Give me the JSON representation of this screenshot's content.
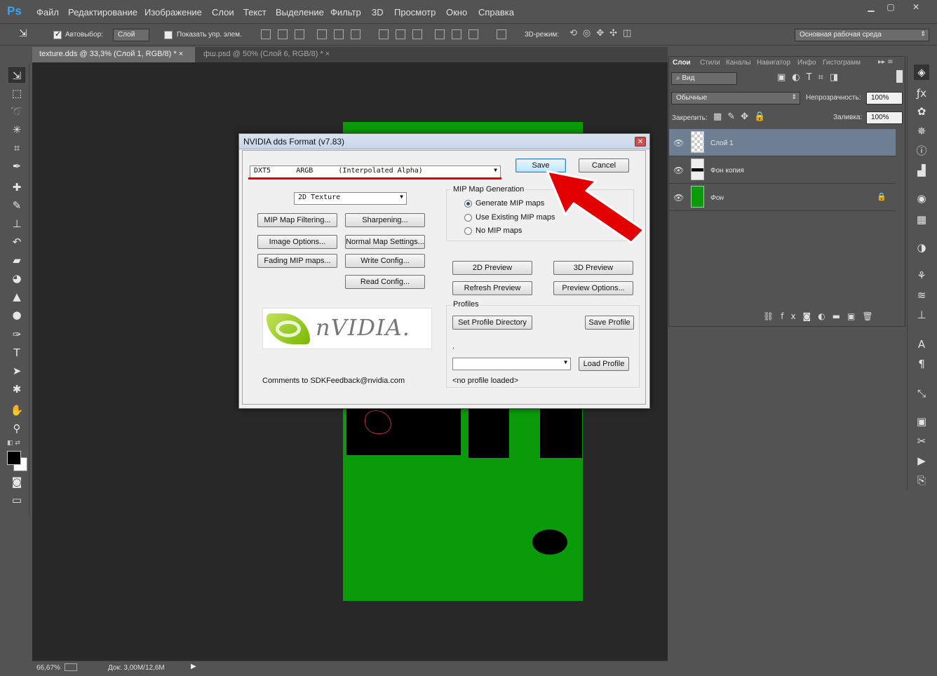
{
  "app": {
    "logo": "Ps"
  },
  "menu": [
    "Файл",
    "Редактирование",
    "Изображение",
    "Слои",
    "Текст",
    "Выделение",
    "Фильтр",
    "3D",
    "Просмотр",
    "Окно",
    "Справка"
  ],
  "window_controls": {
    "minimize": "▁",
    "maximize": "▢",
    "close": "✕"
  },
  "options": {
    "autoselect_label": "Автовыбор:",
    "autoselect_target": "Слой",
    "show_transform_label": "Показать упр. элем.",
    "mode3d_label": "3D-режим:",
    "workspace": "Основная рабочая среда"
  },
  "tabs": [
    {
      "label": "texture.dds @ 33,3% (Слой 1, RGB/8) *",
      "close": "×"
    },
    {
      "label": "фш.psd @ 50% (Слой 6, RGB/8) *",
      "close": "×"
    }
  ],
  "status": {
    "zoom": "66,67%",
    "doc": "Док: 3,00M/12,6M"
  },
  "layers_panel": {
    "tabs": [
      "Слои",
      "Стили",
      "Каналы",
      "Навигатор",
      "Инфо",
      "Гистограмм"
    ],
    "filter_label": "Вид",
    "blend_mode": "Обычные",
    "opacity_label": "Непрозрачность:",
    "opacity_value": "100%",
    "lock_label": "Закрепить:",
    "fill_label": "Заливка:",
    "fill_value": "100%",
    "layers": [
      {
        "name": "Слой 1",
        "selected": true
      },
      {
        "name": "Фон копия",
        "selected": false
      },
      {
        "name": "Фон",
        "selected": false
      }
    ]
  },
  "dialog": {
    "title": "NVIDIA dds Format (v7.83)",
    "close_glyph": "✕",
    "format_select": "DXT5      ARGB      (Interpolated Alpha)",
    "texture_type": "2D Texture",
    "buttons": {
      "save": "Save",
      "cancel": "Cancel",
      "mip_filtering": "MIP Map Filtering...",
      "sharpening": "Sharpening...",
      "image_options": "Image Options...",
      "normal_map": "Normal Map Settings...",
      "fading_mip": "Fading MIP maps...",
      "write_config": "Write Config...",
      "read_config": "Read Config...",
      "preview_2d": "2D Preview",
      "preview_3d": "3D Preview",
      "refresh_preview": "Refresh Preview",
      "preview_options": "Preview Options...",
      "set_profile_dir": "Set Profile Directory",
      "save_profile": "Save Profile",
      "load_profile": "Load Profile"
    },
    "mip_group_title": "MIP Map Generation",
    "mip_options": [
      {
        "label": "Generate MIP maps",
        "checked": true
      },
      {
        "label": "Use Existing MIP maps",
        "checked": false
      },
      {
        "label": "No MIP maps",
        "checked": false
      }
    ],
    "profiles_title": "Profiles",
    "profile_path": ".",
    "profile_select": "",
    "profile_status": "<no profile loaded>",
    "comments": "Comments to SDKFeedback@nvidia.com",
    "logo_text": "nVIDIA."
  },
  "colors": {
    "accent_red": "#e20000",
    "canvas_green": "#0a9a0a",
    "ps_blue": "#31a8ff",
    "selected_layer": "#6f7f93"
  }
}
